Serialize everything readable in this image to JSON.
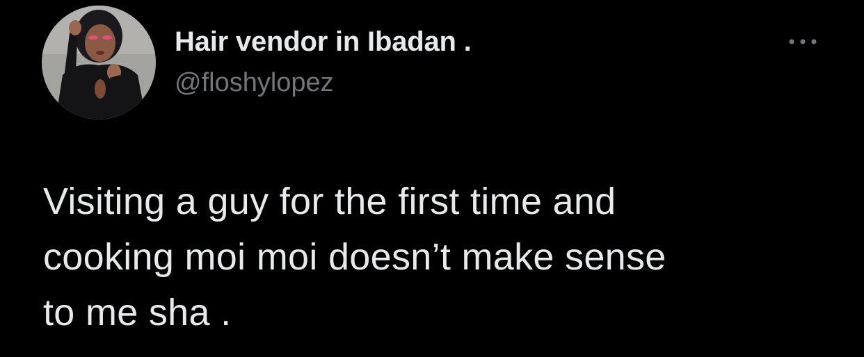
{
  "author": {
    "display_name": "Hair vendor in Ibadan .",
    "handle": "@floshylopez",
    "avatar_icon": "profile-photo"
  },
  "menu": {
    "icon": "more-horizontal-icon"
  },
  "tweet": {
    "lines": [
      "Visiting a guy for the first time and",
      "cooking moi moi doesn’t make sense",
      "to me sha ."
    ]
  },
  "colors": {
    "background": "#000000",
    "primary_text": "#e7e9ea",
    "secondary_text": "#71767b"
  }
}
